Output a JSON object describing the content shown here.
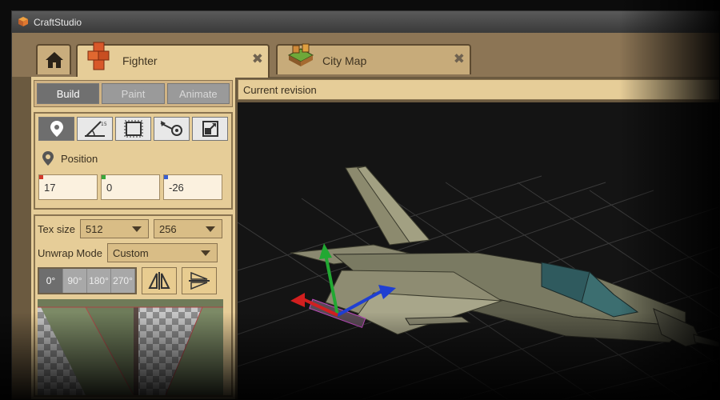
{
  "window": {
    "title": "CraftStudio",
    "app_icon": "craftstudio-cube-icon"
  },
  "tabs": [
    {
      "label": "",
      "icon": "home-icon"
    },
    {
      "label": "Fighter",
      "icon": "model-cubes-icon",
      "close": "✖"
    },
    {
      "label": "City Map",
      "icon": "map-cubes-icon",
      "close": "✖"
    }
  ],
  "modes": [
    {
      "label": "Build",
      "active": true
    },
    {
      "label": "Paint",
      "active": false
    },
    {
      "label": "Animate",
      "active": false
    }
  ],
  "tools": [
    {
      "icon": "move-pin-icon",
      "active": true
    },
    {
      "icon": "rotate-angle-icon",
      "active": false
    },
    {
      "icon": "box-icon",
      "active": false
    },
    {
      "icon": "pivot-icon",
      "active": false
    },
    {
      "icon": "scale-icon",
      "active": false
    }
  ],
  "position": {
    "label": "Position",
    "x": "17",
    "y": "0",
    "z": "-26",
    "axis_colors": [
      "#d23a2a",
      "#3aa83a",
      "#3a5fd2"
    ]
  },
  "texture": {
    "size_label": "Tex size",
    "width": "512",
    "height": "256",
    "unwrap_label": "Unwrap Mode",
    "unwrap_value": "Custom",
    "rotations": [
      "0°",
      "90°",
      "180°",
      "270°"
    ],
    "active_rotation": "0°",
    "flip_buttons": [
      "flip-horizontal-icon",
      "flip-vertical-icon"
    ]
  },
  "viewport": {
    "revision_label": "Current revision",
    "gizmo_colors": {
      "x": "#d21f1f",
      "y": "#22a832",
      "z": "#1f3fd2"
    }
  },
  "colors": {
    "panel": "#e6cd98",
    "frame": "#8a7450",
    "viewport_bg": "#141414"
  }
}
